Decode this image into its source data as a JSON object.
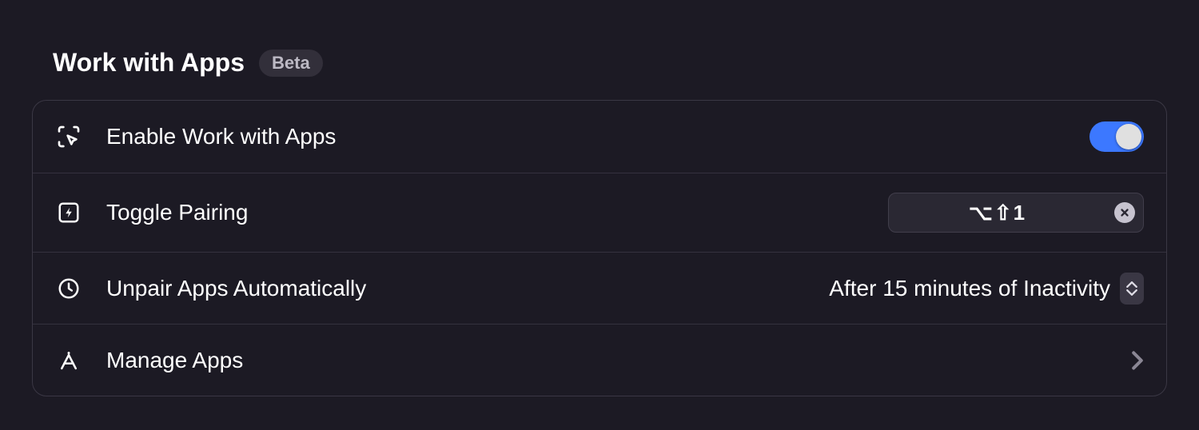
{
  "section": {
    "title": "Work with Apps",
    "badge": "Beta"
  },
  "rows": {
    "enable": {
      "label": "Enable Work with Apps",
      "toggle_on": true
    },
    "pairing": {
      "label": "Toggle Pairing",
      "shortcut": "⌥⇧1"
    },
    "unpair": {
      "label": "Unpair Apps Automatically",
      "value": "After 15 minutes of Inactivity"
    },
    "manage": {
      "label": "Manage Apps"
    }
  }
}
